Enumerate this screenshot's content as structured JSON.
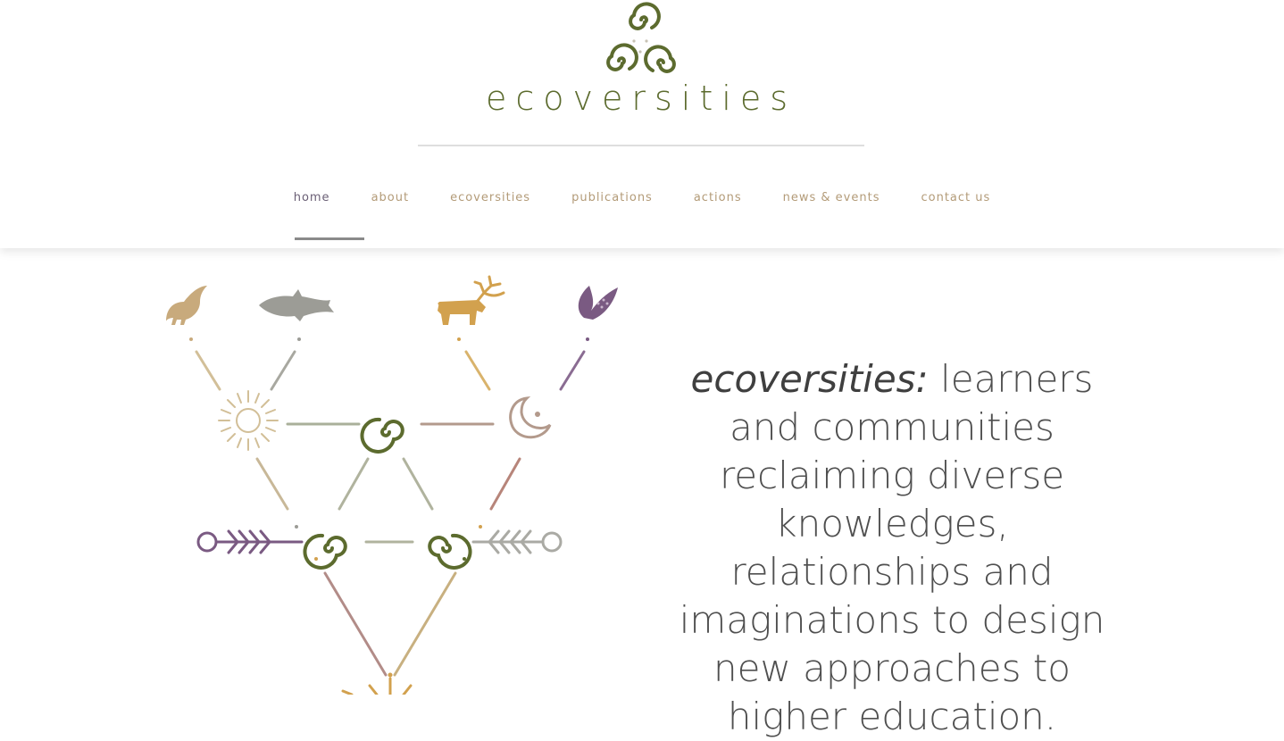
{
  "logo": {
    "wordmark": "ecoversities",
    "icon": "triple-spiral-icon",
    "color": "#5c6b2e"
  },
  "nav": {
    "items": [
      {
        "label": "home",
        "active": true
      },
      {
        "label": "about",
        "active": false
      },
      {
        "label": "ecoversities",
        "active": false
      },
      {
        "label": "publications",
        "active": false
      },
      {
        "label": "actions",
        "active": false
      },
      {
        "label": "news & events",
        "active": false
      },
      {
        "label": "contact us",
        "active": false
      }
    ],
    "active_color": "#6a5f75",
    "inactive_color": "#b39b78"
  },
  "hero": {
    "tagline_emphasis": "ecoversities:",
    "tagline_rest": " learners and communities reclaiming diverse knowledges, relationships and imaginations to design new approaches to higher education."
  },
  "illustration": {
    "icons": [
      "bird-icon",
      "fish-icon",
      "deer-icon",
      "corn-icon",
      "sun-icon",
      "spiral-icon",
      "moon-icon",
      "arrow-left-icon",
      "arrow-right-icon"
    ]
  }
}
